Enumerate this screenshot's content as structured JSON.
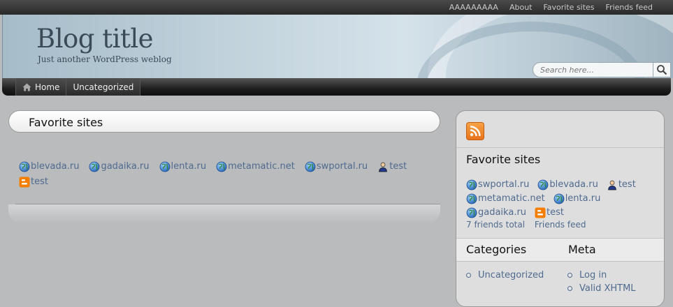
{
  "topnav": [
    "AAAAAAAAA",
    "About",
    "Favorite sites",
    "Friends feed"
  ],
  "header": {
    "title": "Blog title",
    "tagline": "Just another WordPress weblog",
    "search_placeholder": "Search here..."
  },
  "nav": [
    "Home",
    "Uncategorized"
  ],
  "main": {
    "title": "Favorite sites",
    "links": [
      {
        "label": "blevada.ru",
        "icon": "globe-icon"
      },
      {
        "label": "gadaika.ru",
        "icon": "globe-icon"
      },
      {
        "label": "lenta.ru",
        "icon": "globe-icon"
      },
      {
        "label": "metamatic.net",
        "icon": "globe-icon"
      },
      {
        "label": "swportal.ru",
        "icon": "globe-icon"
      },
      {
        "label": "test",
        "icon": "user-icon"
      },
      {
        "label": "test",
        "icon": "blogger-icon"
      }
    ]
  },
  "sidebar": {
    "favorites_title": "Favorite sites",
    "favorites": [
      {
        "label": "swportal.ru",
        "icon": "globe-icon"
      },
      {
        "label": "blevada.ru",
        "icon": "globe-icon"
      },
      {
        "label": "test",
        "icon": "user-icon"
      },
      {
        "label": "metamatic.net",
        "icon": "globe-icon"
      },
      {
        "label": "lenta.ru",
        "icon": "globe-icon"
      },
      {
        "label": "gadaika.ru",
        "icon": "globe-icon"
      },
      {
        "label": "test",
        "icon": "blogger-icon"
      }
    ],
    "friends_total": "7 friends total",
    "friends_feed": "Friends feed",
    "categories_title": "Categories",
    "categories": [
      "Uncategorized"
    ],
    "meta_title": "Meta",
    "meta": [
      "Log in",
      "Valid XHTML"
    ]
  }
}
